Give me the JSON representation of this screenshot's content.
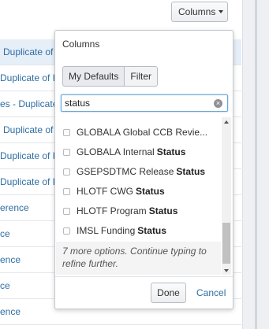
{
  "toolbar": {
    "columns_label": "Columns"
  },
  "table": {
    "rows": [
      {
        "text": "Duplicate of",
        "selected": true
      },
      {
        "text": "Duplicate of K",
        "selected": false
      },
      {
        "text": "es - Duplicate",
        "selected": false
      },
      {
        "text": "Duplicate of",
        "selected": false
      },
      {
        "text": "Duplicate of K",
        "selected": false
      },
      {
        "text": "Duplicate of K",
        "selected": false
      },
      {
        "text": "erence",
        "selected": false
      },
      {
        "text": "ce",
        "selected": false
      },
      {
        "text": "ence",
        "selected": false
      },
      {
        "text": "ce",
        "selected": false
      },
      {
        "text": "ence",
        "selected": false
      }
    ]
  },
  "dropdown": {
    "title": "Columns",
    "tabs": [
      "My Defaults",
      "Filter"
    ],
    "search_value": "status",
    "options": [
      {
        "prefix": "GLOBALA Global CCB Revie...",
        "match": ""
      },
      {
        "prefix": "GLOBALA Internal",
        "match": "Status"
      },
      {
        "prefix": "GSEPSDTMC Release",
        "match": "Status"
      },
      {
        "prefix": "HLOTF CWG",
        "match": "Status"
      },
      {
        "prefix": "HLOTF Program",
        "match": "Status"
      },
      {
        "prefix": "IMSL Funding",
        "match": "Status"
      }
    ],
    "more_text": "7 more options. Continue typing to refine further.",
    "done_label": "Done",
    "cancel_label": "Cancel"
  },
  "colors": {
    "link": "#2e6da4",
    "selected_row": "#e6eef8",
    "focus": "#6aa8d8"
  }
}
